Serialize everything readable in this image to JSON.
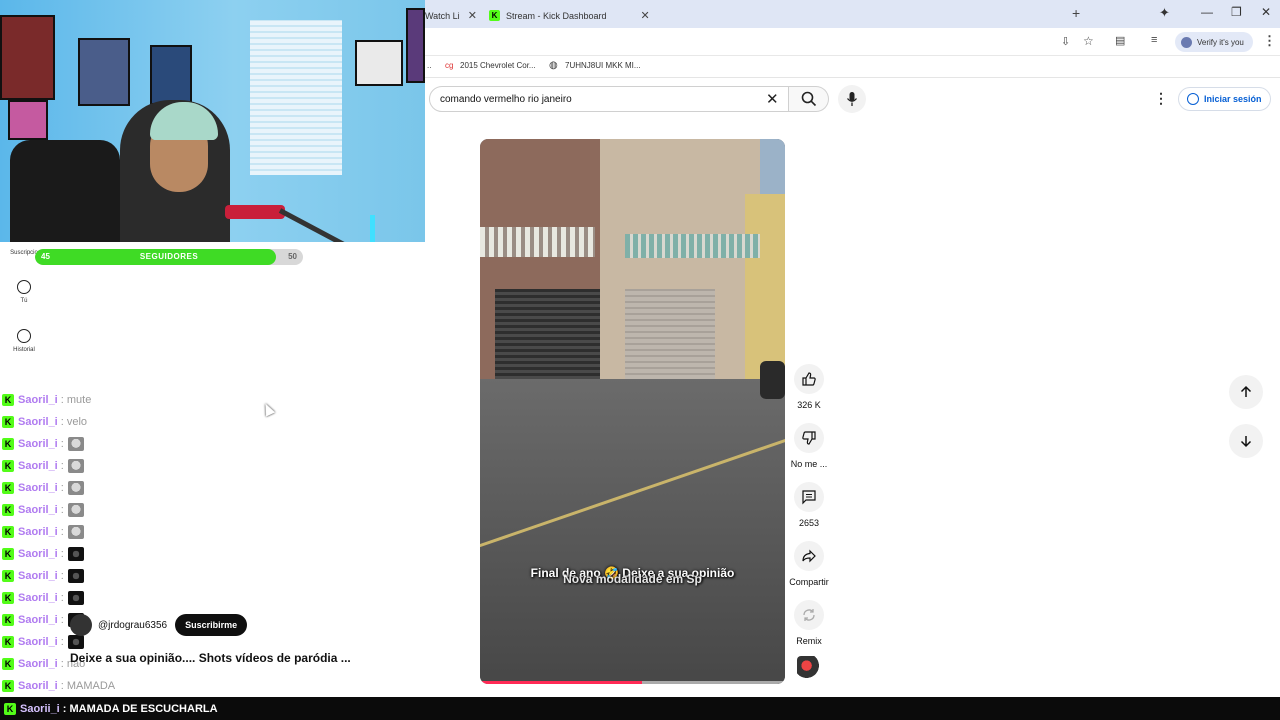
{
  "browser": {
    "tabs": [
      {
        "label": "Watch Li"
      },
      {
        "label": "Stream - Kick Dashboard"
      }
    ],
    "new_tab": "+",
    "verify_label": "Verify it's you",
    "bookmarks": [
      "2015 Chevrolet Cor...",
      "7UHNJ8UI MKK MI..."
    ]
  },
  "youtube": {
    "search_value": "comando vermelho rio janeiro",
    "signin_label": "Iniciar sesión",
    "sidebar": [
      {
        "label": "Suscripcio"
      },
      {
        "label": "Tú"
      },
      {
        "label": "Historial"
      }
    ],
    "video": {
      "caption_top": "Final de ano 🤣 Deixe a sua opinião",
      "caption_bottom": "Nova modalidade em Sp",
      "progress": 0.53
    },
    "actions": {
      "like_count": "326 K",
      "dislike_label": "No me ...",
      "comments_count": "2653",
      "share_label": "Compartir",
      "remix_label": "Remix"
    },
    "channel": {
      "handle": "@jrdograu6356",
      "subscribe_label": "Suscribirme"
    },
    "video_title": "Deixe a sua opinião.... Shots vídeos de paródia ..."
  },
  "stream": {
    "followers": {
      "current": "45",
      "label": "SEGUIDORES",
      "goal": "50",
      "progress": 0.9
    },
    "chat": [
      {
        "user": "Saoril_i",
        "msg": ": mute",
        "emote": ""
      },
      {
        "user": "Saoril_i",
        "msg": ": velo",
        "emote": ""
      },
      {
        "user": "Saoril_i",
        "msg": ":",
        "emote": "cat"
      },
      {
        "user": "Saoril_i",
        "msg": ":",
        "emote": "cat"
      },
      {
        "user": "Saoril_i",
        "msg": ":",
        "emote": "cat"
      },
      {
        "user": "Saoril_i",
        "msg": ":",
        "emote": "cat"
      },
      {
        "user": "Saoril_i",
        "msg": ":",
        "emote": "cat"
      },
      {
        "user": "Saoril_i",
        "msg": ":",
        "emote": "dark"
      },
      {
        "user": "Saoril_i",
        "msg": ":",
        "emote": "dark"
      },
      {
        "user": "Saoril_i",
        "msg": ":",
        "emote": "dark"
      },
      {
        "user": "Saoril_i",
        "msg": ":",
        "emote": "dark"
      },
      {
        "user": "Saoril_i",
        "msg": ":",
        "emote": "dark"
      },
      {
        "user": "Saoril_i",
        "msg": ": nao",
        "emote": ""
      },
      {
        "user": "Saoril_i",
        "msg": ": MAMADA",
        "emote": ""
      }
    ],
    "bottom_message": {
      "user": "Saorii_i",
      "msg": ": MAMADA DE ESCUCHARLA"
    }
  },
  "colors": {
    "kick_green": "#53fc18",
    "yt_red": "#ff0033",
    "link_blue": "#065fd4"
  }
}
